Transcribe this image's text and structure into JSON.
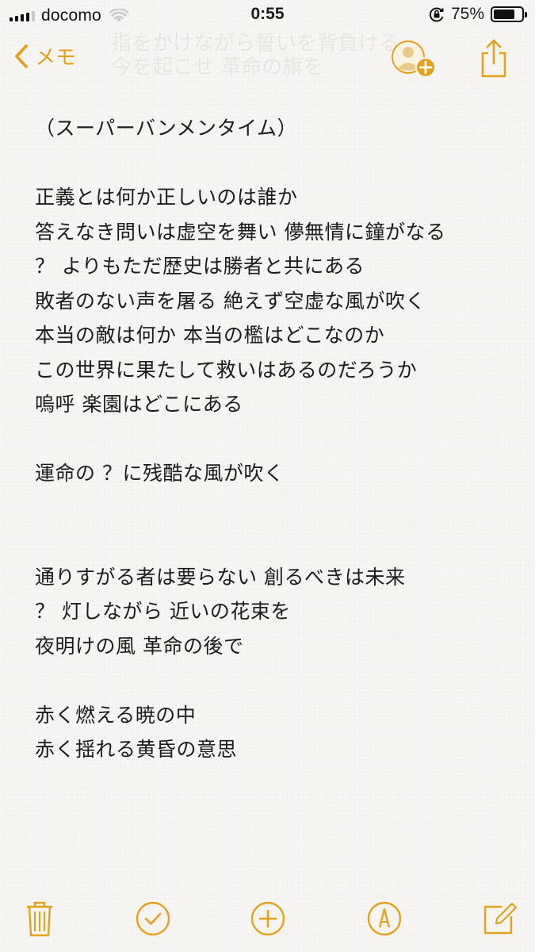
{
  "status_bar": {
    "carrier": "docomo",
    "time": "0:55",
    "battery_percent": "75%",
    "battery_level": 0.75,
    "signal_bars_filled": 4,
    "signal_bars_total": 5
  },
  "nav": {
    "back_label": "メモ",
    "ghost_lines": [
      "指をかけながら誓いを背負ける",
      "今を起こせ 革命の旗を"
    ]
  },
  "note": {
    "lines": [
      "（スーパーバンメンタイム）",
      "",
      "正義とは何か正しいのは誰か",
      "答えなき問いは虚空を舞い 儚無情に鐘がなる",
      " ？ よりもただ歴史は勝者と共にある",
      "敗者のない声を屠る 絶えず空虚な風が吹く",
      "本当の敵は何か 本当の檻はどこなのか",
      "この世界に果たして救いはあるのだろうか",
      "嗚呼 楽園はどこにある",
      "",
      "運命の ？に残酷な風が吹く",
      "",
      "",
      "通りすがる者は要らない 創るべきは未来",
      "？ 灯しながら 近いの花束を",
      "夜明けの風 革命の後で",
      "",
      "赤く燃える暁の中",
      "赤く揺れる黄昏の意思"
    ]
  },
  "toolbar": {
    "buttons": [
      "trash-icon",
      "checklist-icon",
      "add-icon",
      "markup-icon",
      "compose-icon"
    ]
  },
  "colors": {
    "accent": "#e3a21a",
    "background": "#f6f5f2",
    "text": "#1c1c1c"
  }
}
